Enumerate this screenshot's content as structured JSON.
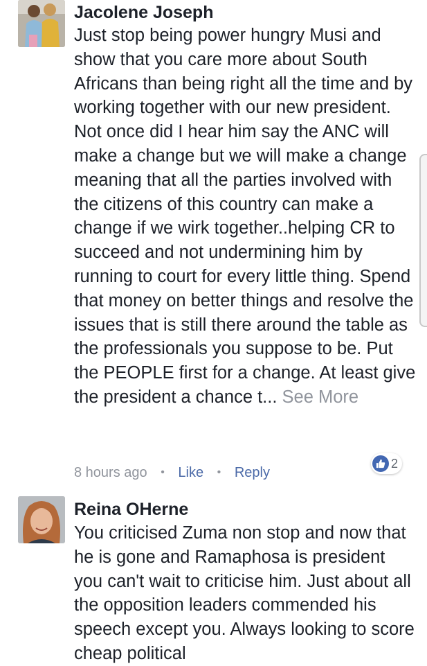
{
  "comments": [
    {
      "author": "Jacolene Joseph",
      "avatar_icon": "profile-photo-two-women",
      "text": "Just stop being power hungry Musi and show that you care more about South Africans than being right all the time and by working together with our new president. Not once did I hear him say the ANC will make a change but we will make a change meaning that all the parties involved with the citizens of this country can make a change if we wirk together..helping CR to succeed and not undermining him by running to court for every little thing. Spend that money on better things and resolve the issues that is still there around the table as the professionals you suppose to be. Put the PEOPLE first for a change. At least give the president a chance t...",
      "see_more": "See More",
      "timestamp": "8 hours ago",
      "like_label": "Like",
      "reply_label": "Reply",
      "reaction_count": "2"
    },
    {
      "author": "Reina OHerne",
      "avatar_icon": "profile-photo-woman",
      "text": "You criticised Zuma non stop and now that he is gone and Ramaphosa is president you can't wait to criticise him. Just about all the opposition leaders commended his speech except you. Always looking to score cheap political"
    }
  ],
  "colors": {
    "author_text": "#1d2129",
    "muted_text": "#90949c",
    "action_text": "#4b6aa8",
    "like_badge": "#4267b2"
  }
}
